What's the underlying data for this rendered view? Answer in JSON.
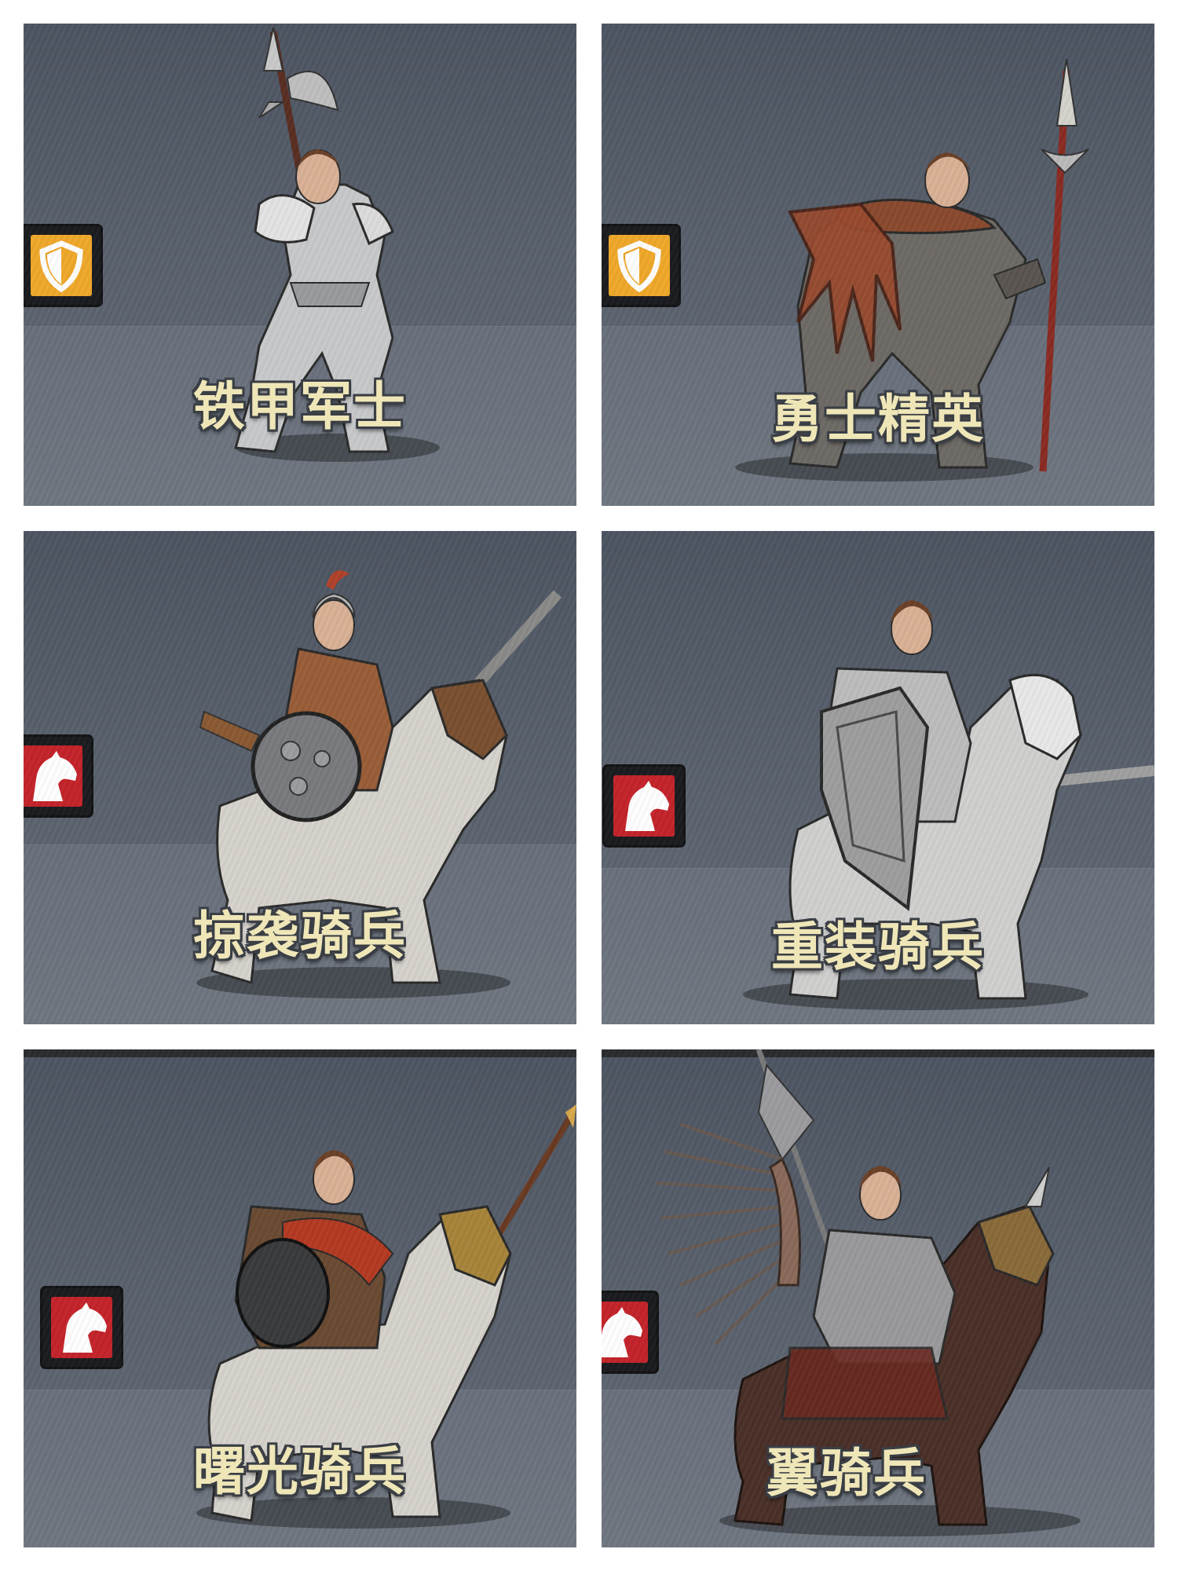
{
  "units": [
    {
      "name": "铁甲军士",
      "type_icon": "shield-icon",
      "type_color": "#f0a82a"
    },
    {
      "name": "勇士精英",
      "type_icon": "shield-icon",
      "type_color": "#f0a82a"
    },
    {
      "name": "掠袭骑兵",
      "type_icon": "horse-head-icon",
      "type_color": "#c4242a"
    },
    {
      "name": "重装骑兵",
      "type_icon": "horse-head-icon",
      "type_color": "#c4242a"
    },
    {
      "name": "曙光骑兵",
      "type_icon": "horse-head-icon",
      "type_color": "#c4242a"
    },
    {
      "name": "翼骑兵",
      "type_icon": "horse-head-icon",
      "type_color": "#c4242a"
    }
  ]
}
